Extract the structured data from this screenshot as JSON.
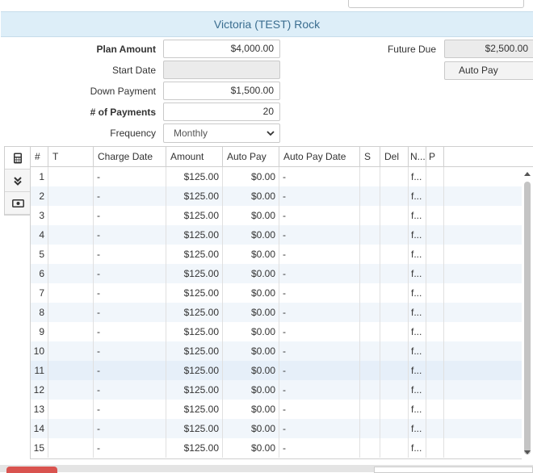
{
  "header": {
    "title": "Victoria (TEST) Rock"
  },
  "form": {
    "plan_amount_label": "Plan Amount",
    "plan_amount_value": "$4,000.00",
    "start_date_label": "Start Date",
    "start_date_value": "",
    "down_payment_label": "Down Payment",
    "down_payment_value": "$1,500.00",
    "num_payments_label": "# of Payments",
    "num_payments_value": "20",
    "frequency_label": "Frequency",
    "frequency_value": "Monthly",
    "future_due_label": "Future Due",
    "future_due_value": "$2,500.00",
    "auto_pay_button": "Auto Pay"
  },
  "table": {
    "columns": [
      "#",
      "T",
      "Charge Date",
      "Amount",
      "Auto Pay",
      "Auto Pay Date",
      "S",
      "Del",
      "N...",
      "P"
    ],
    "rows": [
      {
        "num": "1",
        "t": "",
        "charge_date": "-",
        "amount": "$125.00",
        "auto_pay": "$0.00",
        "auto_pay_date": "-",
        "s": "",
        "del": "",
        "n": "f...",
        "p": ""
      },
      {
        "num": "2",
        "t": "",
        "charge_date": "-",
        "amount": "$125.00",
        "auto_pay": "$0.00",
        "auto_pay_date": "-",
        "s": "",
        "del": "",
        "n": "f...",
        "p": ""
      },
      {
        "num": "3",
        "t": "",
        "charge_date": "-",
        "amount": "$125.00",
        "auto_pay": "$0.00",
        "auto_pay_date": "-",
        "s": "",
        "del": "",
        "n": "f...",
        "p": ""
      },
      {
        "num": "4",
        "t": "",
        "charge_date": "-",
        "amount": "$125.00",
        "auto_pay": "$0.00",
        "auto_pay_date": "-",
        "s": "",
        "del": "",
        "n": "f...",
        "p": ""
      },
      {
        "num": "5",
        "t": "",
        "charge_date": "-",
        "amount": "$125.00",
        "auto_pay": "$0.00",
        "auto_pay_date": "-",
        "s": "",
        "del": "",
        "n": "f...",
        "p": ""
      },
      {
        "num": "6",
        "t": "",
        "charge_date": "-",
        "amount": "$125.00",
        "auto_pay": "$0.00",
        "auto_pay_date": "-",
        "s": "",
        "del": "",
        "n": "f...",
        "p": ""
      },
      {
        "num": "7",
        "t": "",
        "charge_date": "-",
        "amount": "$125.00",
        "auto_pay": "$0.00",
        "auto_pay_date": "-",
        "s": "",
        "del": "",
        "n": "f...",
        "p": ""
      },
      {
        "num": "8",
        "t": "",
        "charge_date": "-",
        "amount": "$125.00",
        "auto_pay": "$0.00",
        "auto_pay_date": "-",
        "s": "",
        "del": "",
        "n": "f...",
        "p": ""
      },
      {
        "num": "9",
        "t": "",
        "charge_date": "-",
        "amount": "$125.00",
        "auto_pay": "$0.00",
        "auto_pay_date": "-",
        "s": "",
        "del": "",
        "n": "f...",
        "p": ""
      },
      {
        "num": "10",
        "t": "",
        "charge_date": "-",
        "amount": "$125.00",
        "auto_pay": "$0.00",
        "auto_pay_date": "-",
        "s": "",
        "del": "",
        "n": "f...",
        "p": ""
      },
      {
        "num": "11",
        "t": "",
        "charge_date": "-",
        "amount": "$125.00",
        "auto_pay": "$0.00",
        "auto_pay_date": "-",
        "s": "",
        "del": "",
        "n": "f...",
        "p": ""
      },
      {
        "num": "12",
        "t": "",
        "charge_date": "-",
        "amount": "$125.00",
        "auto_pay": "$0.00",
        "auto_pay_date": "-",
        "s": "",
        "del": "",
        "n": "f...",
        "p": ""
      },
      {
        "num": "13",
        "t": "",
        "charge_date": "-",
        "amount": "$125.00",
        "auto_pay": "$0.00",
        "auto_pay_date": "-",
        "s": "",
        "del": "",
        "n": "f...",
        "p": ""
      },
      {
        "num": "14",
        "t": "",
        "charge_date": "-",
        "amount": "$125.00",
        "auto_pay": "$0.00",
        "auto_pay_date": "-",
        "s": "",
        "del": "",
        "n": "f...",
        "p": ""
      },
      {
        "num": "15",
        "t": "",
        "charge_date": "-",
        "amount": "$125.00",
        "auto_pay": "$0.00",
        "auto_pay_date": "-",
        "s": "",
        "del": "",
        "n": "f...",
        "p": ""
      }
    ],
    "highlighted_row": "11"
  },
  "icons": {
    "tool_1": "calculator-icon",
    "tool_2": "double-chevron-down-icon",
    "tool_3": "cash-icon"
  },
  "colors": {
    "header_bg": "#ddeef8",
    "header_text": "#3a6d8f",
    "row_alt": "#f1f6fb",
    "row_highlight": "#e6eff9",
    "danger": "#d9534f"
  }
}
